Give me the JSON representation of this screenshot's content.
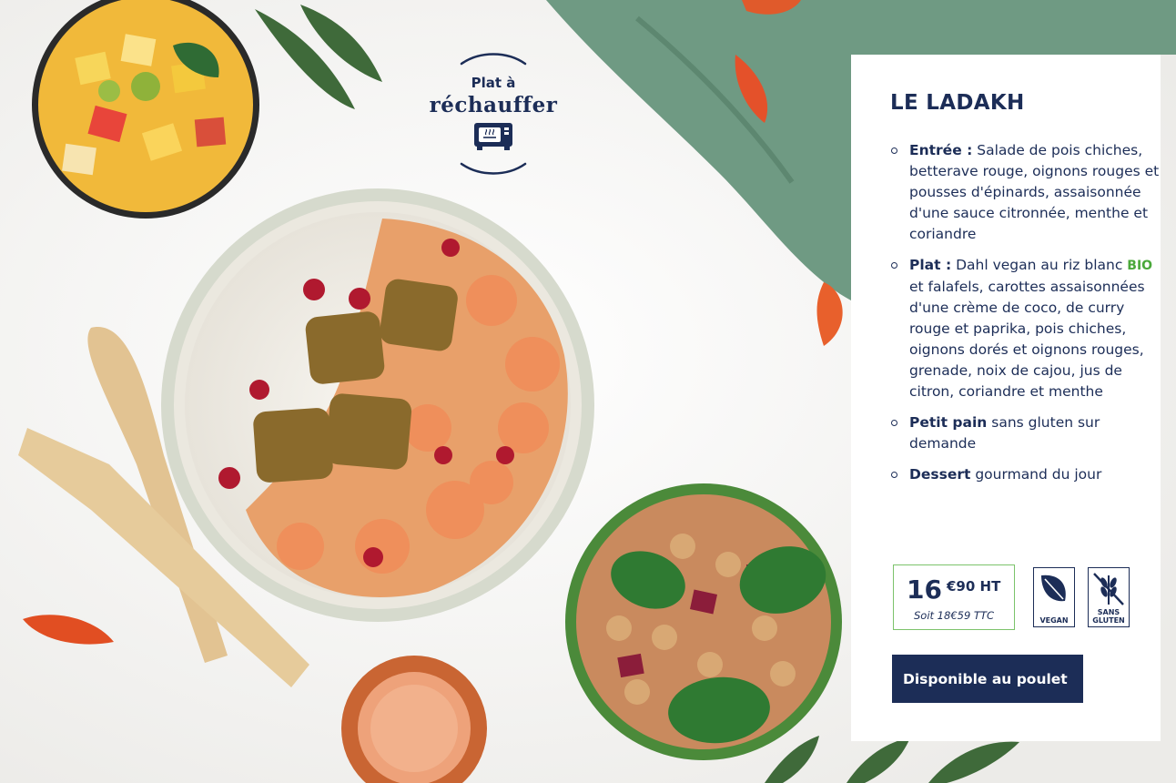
{
  "badge": {
    "line1": "Plat à",
    "line2": "réchauffer",
    "icon": "microwave-icon"
  },
  "menu": {
    "title": "LE LADAKH",
    "items": [
      {
        "label": "Entrée :",
        "text": "Salade de pois chiches, betterave rouge, oignons rouges et pousses d'épinards, assaisonnée d'une sauce citronnée, menthe et coriandre"
      },
      {
        "label": "Plat :",
        "text_before": "Dahl vegan au riz blanc",
        "bio_tag": "BIO",
        "text_after": "et falafels, carottes assaisonnées d'une crème de coco, de curry rouge et paprika, pois chiches, oignons dorés et oignons rouges, grenade, noix de cajou, jus de citron, coriandre et menthe"
      },
      {
        "label": "Petit pain",
        "text": "sans gluten sur demande"
      },
      {
        "label": "Dessert",
        "text": "gourmand du jour"
      }
    ]
  },
  "price": {
    "euros": "16",
    "cents": "€90 HT",
    "ttc": "Soit 18€59 TTC"
  },
  "labels": {
    "vegan": "VEGAN",
    "gluten_line1": "SANS",
    "gluten_line2": "GLUTEN"
  },
  "cta": {
    "label": "Disponible au poulet"
  },
  "colors": {
    "navy": "#1c2d57",
    "green": "#4aa83a",
    "price_border": "#7cc36b"
  }
}
